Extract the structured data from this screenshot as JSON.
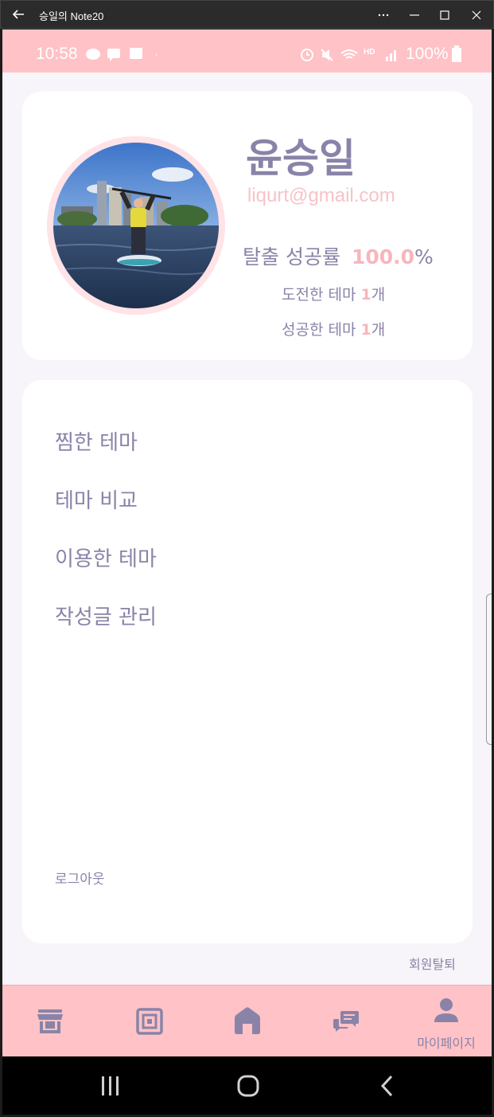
{
  "window": {
    "title": "승일의 Note20"
  },
  "status_bar": {
    "time": "10:58",
    "battery": "100%"
  },
  "profile": {
    "name": "윤승일",
    "email": "liqurt@gmail.com",
    "success_rate_label": "탈출 성공률",
    "success_rate_value": "100.0",
    "success_rate_unit": "%",
    "challenged_label": "도전한 테마",
    "challenged_count": "1",
    "challenged_unit": "개",
    "succeeded_label": "성공한 테마",
    "succeeded_count": "1",
    "succeeded_unit": "개"
  },
  "menu": {
    "items": [
      {
        "label": "찜한 테마"
      },
      {
        "label": "테마 비교"
      },
      {
        "label": "이용한 테마"
      },
      {
        "label": "작성글 관리"
      }
    ],
    "logout": "로그아웃"
  },
  "withdraw": "회원탈퇴",
  "bottom_nav": {
    "items": [
      {
        "icon": "store-icon",
        "label": ""
      },
      {
        "icon": "frame-icon",
        "label": ""
      },
      {
        "icon": "home-icon",
        "label": ""
      },
      {
        "icon": "chat-icon",
        "label": ""
      },
      {
        "icon": "person-icon",
        "label": "마이페이지"
      }
    ],
    "active_index": 4
  },
  "colors": {
    "accent_pink": "#ffc2c6",
    "text_purple": "#8a83a8",
    "number_pink": "#f7b6bc"
  }
}
